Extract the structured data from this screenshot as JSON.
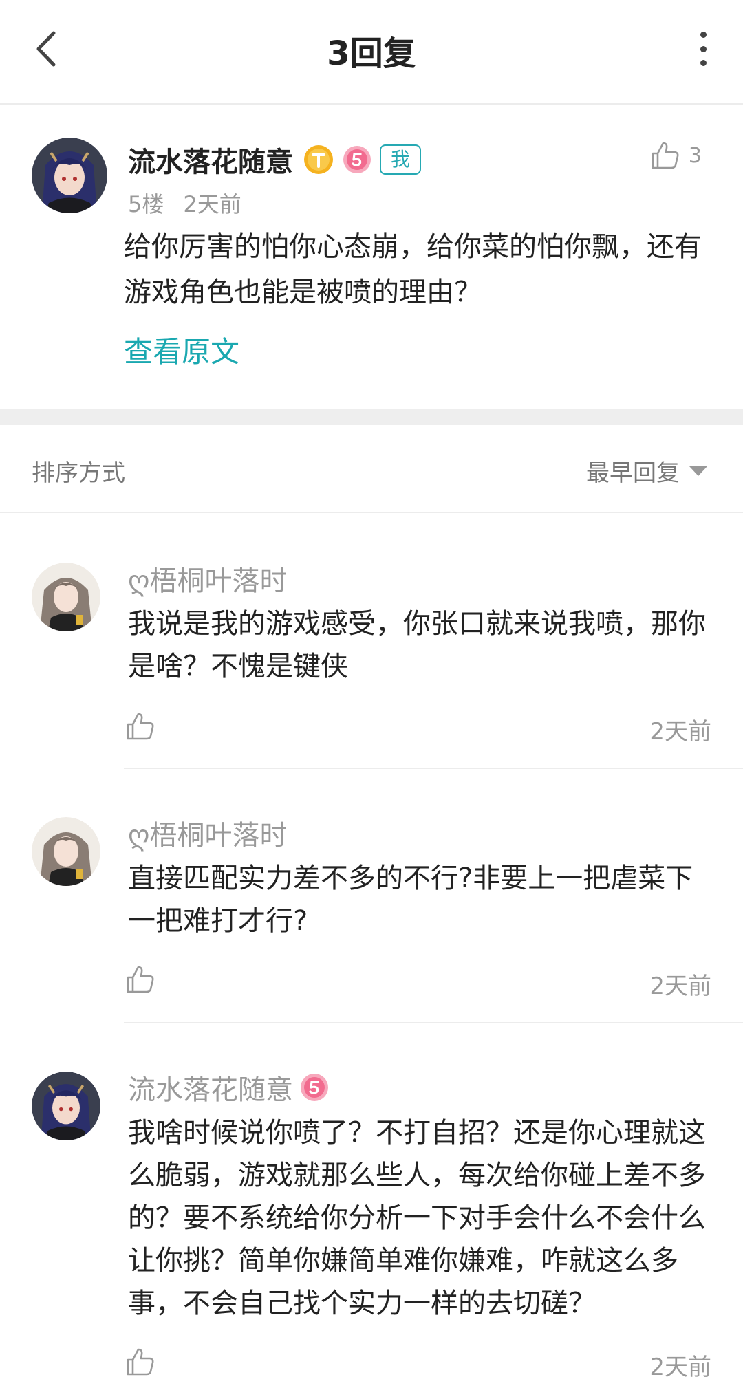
{
  "header": {
    "title": "3回复"
  },
  "main_post": {
    "author": "流水落花随意",
    "badge_me": "我",
    "like_count": "3",
    "floor": "5楼",
    "time": "2天前",
    "content": "给你厉害的怕你心态崩，给你菜的怕你飘，还有游戏角色也能是被喷的理由？",
    "view_original": "查看原文"
  },
  "sort": {
    "label": "排序方式",
    "selected": "最早回复"
  },
  "replies": [
    {
      "author": "ღ梧桐叶落时",
      "content": "我说是我的游戏感受，你张口就来说我喷，那你是啥？不愧是键侠",
      "time": "2天前"
    },
    {
      "author": "ღ梧桐叶落时",
      "content": "直接匹配实力差不多的不行?非要上一把虐菜下一把难打才行?",
      "time": "2天前"
    },
    {
      "author": "流水落花随意",
      "content": "我啥时候说你喷了？不打自招？还是你心理就这么脆弱，游戏就那么些人，每次给你碰上差不多的？要不系统给你分析一下对手会什么不会什么让你挑？简单你嫌简单难你嫌难，咋就这么多事，不会自己找个实力一样的去切磋？",
      "time": "2天前"
    }
  ],
  "colors": {
    "accent": "#1aa8b0",
    "badge_gold": "#f5b21f",
    "badge_pink": "#f26b8f"
  },
  "icons": [
    "back-arrow-icon",
    "more-vertical-icon",
    "thumbs-up-icon",
    "sort-dropdown-arrow-icon"
  ]
}
